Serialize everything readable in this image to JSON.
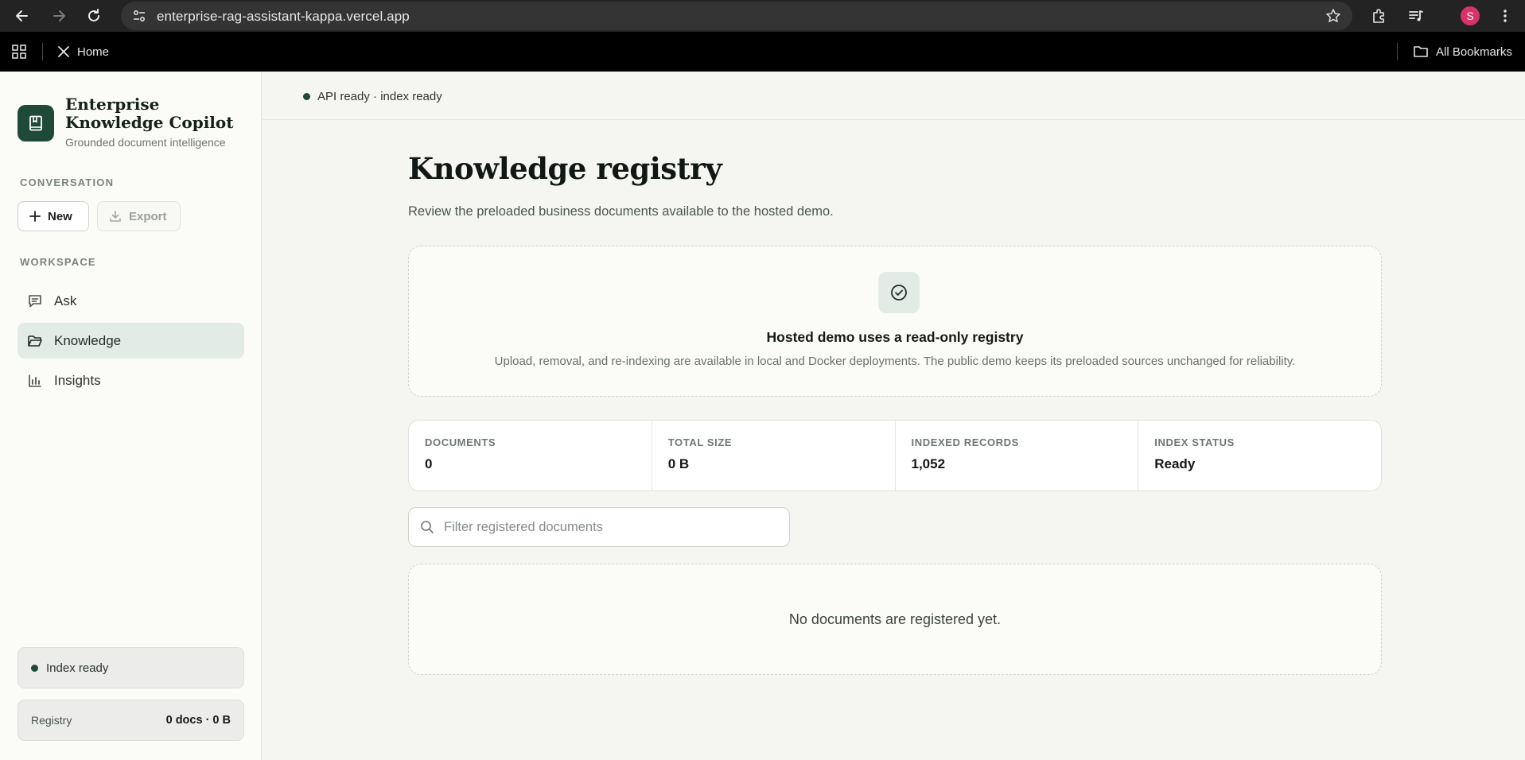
{
  "browser": {
    "url": "enterprise-rag-assistant-kappa.vercel.app",
    "profile_initial": "S",
    "bookmarks": [
      {
        "label": "Home",
        "icon": "x-logo-icon"
      }
    ],
    "all_bookmarks_label": "All Bookmarks",
    "colors": {
      "profile": "#d6336c"
    }
  },
  "brand": {
    "title": "Enterprise Knowledge Copilot",
    "subtitle": "Grounded document intelligence",
    "icon": "book-icon",
    "color": "#1f4a3a"
  },
  "sidebar": {
    "conversation_label": "CONVERSATION",
    "new_label": "New",
    "export_label": "Export",
    "workspace_label": "WORKSPACE",
    "items": [
      {
        "label": "Ask",
        "icon": "chat-icon",
        "active": false
      },
      {
        "label": "Knowledge",
        "icon": "folder-icon",
        "active": true
      },
      {
        "label": "Insights",
        "icon": "bar-chart-icon",
        "active": false
      }
    ],
    "index_status": "Index ready",
    "registry_label": "Registry",
    "registry_value": "0 docs · 0 B"
  },
  "main": {
    "api_status": "API ready · index ready",
    "title": "Knowledge registry",
    "subtitle": "Review the preloaded business documents available to the hosted demo.",
    "notice": {
      "icon": "check-circle-icon",
      "title": "Hosted demo uses a read-only registry",
      "text": "Upload, removal, and re-indexing are available in local and Docker deployments. The public demo keeps its preloaded sources unchanged for reliability."
    },
    "stats": [
      {
        "label": "DOCUMENTS",
        "value": "0"
      },
      {
        "label": "TOTAL SIZE",
        "value": "0 B"
      },
      {
        "label": "INDEXED RECORDS",
        "value": "1,052"
      },
      {
        "label": "INDEX STATUS",
        "value": "Ready"
      }
    ],
    "filter_placeholder": "Filter registered documents",
    "empty_message": "No documents are registered yet."
  }
}
